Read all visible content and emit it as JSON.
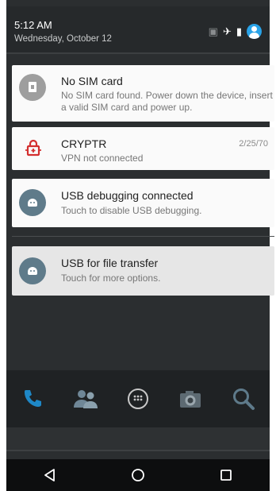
{
  "status_header": {
    "time": "5:12 AM",
    "date": "Wednesday, October 12"
  },
  "notifications": [
    {
      "title": "No SIM card",
      "text": "No SIM card found. Power down the device, insert a valid SIM card and power up.",
      "icon": "sim-card-icon"
    },
    {
      "title": "CRYPTR",
      "text": "VPN not connected",
      "time": "2/25/70",
      "icon": "cryptr-lock-icon"
    },
    {
      "title": "USB debugging connected",
      "text": "Touch to disable USB debugging.",
      "icon": "android-icon"
    },
    {
      "title": "USB for file transfer",
      "text": "Touch for more options.",
      "icon": "android-icon"
    }
  ],
  "dock": [
    "phone-icon",
    "contacts-icon",
    "apps-icon",
    "camera-icon",
    "search-icon"
  ],
  "navbar": [
    "back-icon",
    "home-icon",
    "recents-icon"
  ],
  "colors": {
    "accent": "#29a3e8",
    "cryptr": "#d32f2f",
    "android_badge": "#5f7b8a"
  }
}
